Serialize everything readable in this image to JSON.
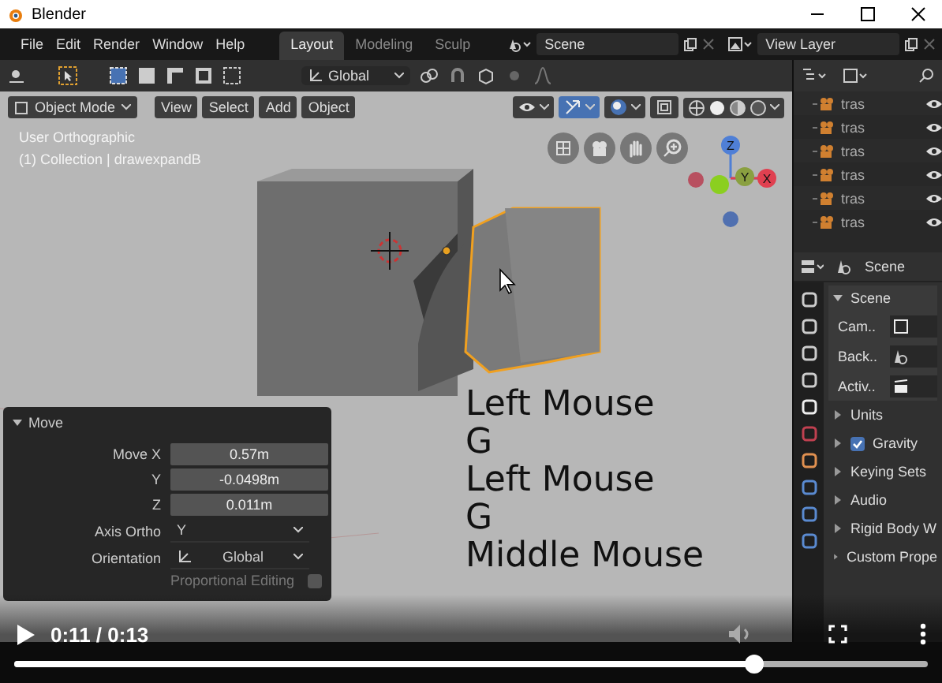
{
  "window": {
    "title": "Blender"
  },
  "menu": [
    "File",
    "Edit",
    "Render",
    "Window",
    "Help"
  ],
  "workspace_tabs": [
    {
      "label": "Layout",
      "selected": true
    },
    {
      "label": "Modeling",
      "selected": false
    },
    {
      "label": "Sculp",
      "selected": false
    }
  ],
  "scene_field": {
    "value": "Scene"
  },
  "view_layer_field": {
    "value": "View Layer"
  },
  "tool_header": {
    "orientation": "Global"
  },
  "viewport_header": {
    "mode": "Object Mode",
    "menus": [
      "View",
      "Select",
      "Add",
      "Object"
    ]
  },
  "viewport": {
    "view_name": "User Orthographic",
    "collection": "(1) Collection | drawexpandB",
    "gizmo_axes": [
      "Z",
      "Y",
      "X"
    ]
  },
  "outliner": {
    "items": [
      {
        "label": "tras"
      },
      {
        "label": "tras"
      },
      {
        "label": "tras"
      },
      {
        "label": "tras"
      },
      {
        "label": "tras"
      },
      {
        "label": "tras"
      }
    ]
  },
  "properties": {
    "context": "Scene",
    "panel": {
      "title": "Scene",
      "expanded": true,
      "fields": [
        {
          "label": "Cam.."
        },
        {
          "label": "Back.."
        },
        {
          "label": "Activ.."
        }
      ]
    },
    "sections": [
      {
        "title": "Units",
        "kind": "plain",
        "expanded": false
      },
      {
        "title": "Gravity",
        "kind": "checkbox",
        "expanded": false,
        "checked": true
      },
      {
        "title": "Keying Sets",
        "kind": "plain",
        "expanded": false
      },
      {
        "title": "Audio",
        "kind": "plain",
        "expanded": false
      },
      {
        "title": "Rigid Body W",
        "kind": "plain",
        "expanded": false
      },
      {
        "title": "Custom Prope",
        "kind": "plain",
        "expanded": false
      }
    ]
  },
  "move_panel": {
    "title": "Move",
    "expanded": true,
    "fields": [
      {
        "label": "Move X",
        "value": "0.57m"
      },
      {
        "label": "Y",
        "value": "-0.0498m"
      },
      {
        "label": "Z",
        "value": "0.011m"
      }
    ],
    "axis_ortho": {
      "label": "Axis Ortho",
      "value": "Y"
    },
    "orientation": {
      "label": "Orientation",
      "value": "Global"
    },
    "proportional_editing": {
      "label": "Proportional Editing",
      "checked": false
    }
  },
  "key_overlay": [
    "Left Mouse",
    "G",
    "Left Mouse",
    "G",
    "Middle Mouse"
  ],
  "video": {
    "time": "0:11 / 0:13",
    "progress": {
      "level": 0.81
    }
  }
}
